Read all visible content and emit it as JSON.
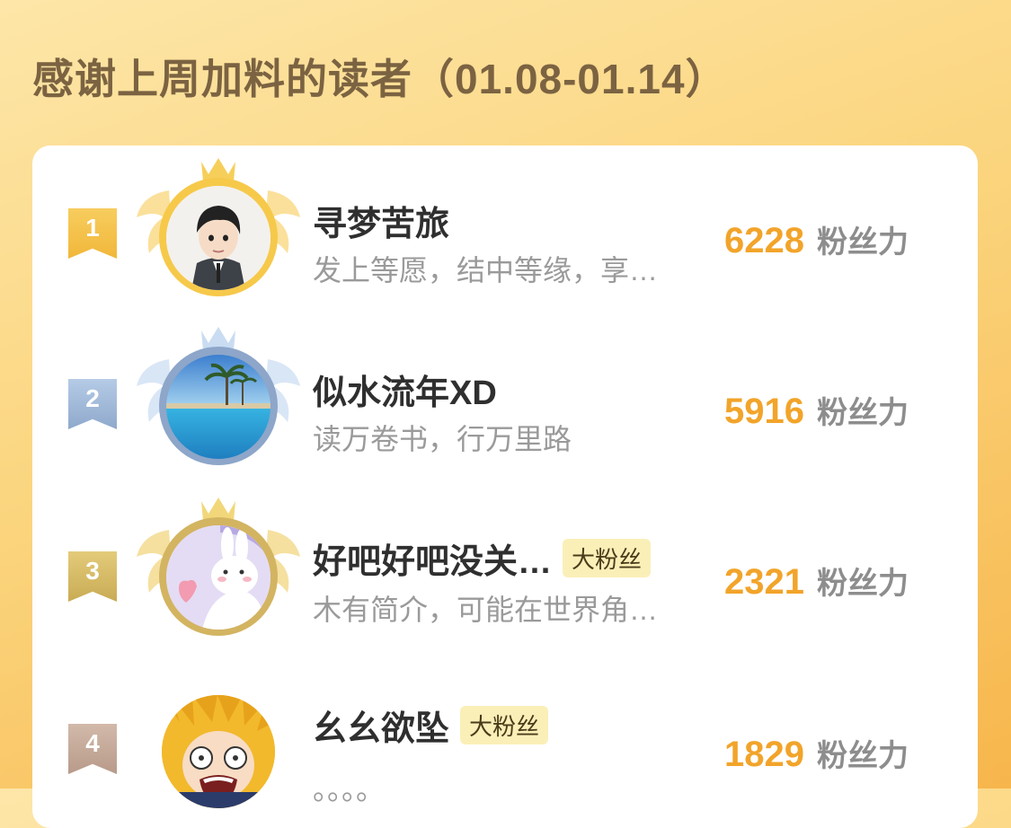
{
  "page": {
    "title": "感谢上周加料的读者（01.08-01.14）"
  },
  "colors": {
    "gold": "#f2a42a",
    "rank1": "#f5c04a",
    "rank2": "#9db8d8",
    "rank3": "#d8bc64",
    "rank4": "#c7ab9b"
  },
  "readers": [
    {
      "rank": "1",
      "name": "寻梦苦旅",
      "bio": "发上等愿，结中等缘，享…",
      "score": "6228",
      "unit": "粉丝力",
      "tag": "",
      "avatar_icon": "cartoon-man-avatar"
    },
    {
      "rank": "2",
      "name": "似水流年XD",
      "bio": "读万卷书，行万里路",
      "score": "5916",
      "unit": "粉丝力",
      "tag": "",
      "avatar_icon": "beach-pool-avatar"
    },
    {
      "rank": "3",
      "name": "好吧好吧没关…",
      "bio": "木有简介，可能在世界角…",
      "score": "2321",
      "unit": "粉丝力",
      "tag": "大粉丝",
      "avatar_icon": "bunny-heart-avatar"
    },
    {
      "rank": "4",
      "name": "幺幺欲坠",
      "bio": "。。。。",
      "score": "1829",
      "unit": "粉丝力",
      "tag": "大粉丝",
      "avatar_icon": "anime-boy-avatar"
    }
  ]
}
